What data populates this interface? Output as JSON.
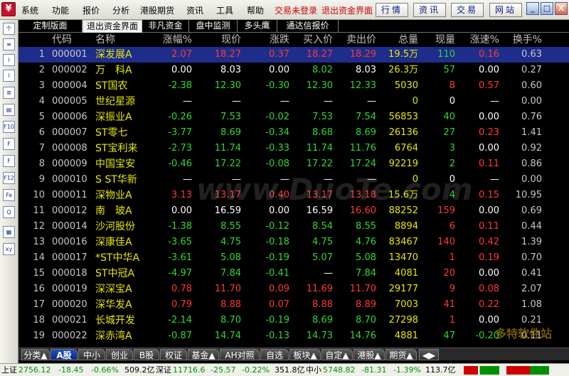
{
  "menubar": {
    "items": [
      "系统",
      "功能",
      "报价",
      "分析",
      "港股期货",
      "资讯",
      "工具",
      "帮助"
    ],
    "status_texts": [
      "交易未登录",
      "退出资金界面"
    ],
    "toolbar_buttons": [
      "行情",
      "资讯",
      "交易",
      "网站"
    ],
    "window_buttons": [
      "_",
      "□",
      "X"
    ]
  },
  "left_toolbar": [
    "个",
    "≡",
    "⌇",
    "⌇",
    "≣",
    "▤",
    "F10",
    "F",
    "F",
    "F12",
    "Fa",
    "Q",
    "▦",
    "xy"
  ],
  "tabs": [
    "定制版面",
    "退出资金界面",
    "非凡资金",
    "盘中监测",
    "多头鹰",
    "通达信报价"
  ],
  "active_tab_index": 1,
  "columns": [
    "代码",
    "名称",
    "涨幅%",
    "现价",
    "涨跌",
    "买入价",
    "卖出价",
    "总量",
    "现量",
    "涨速%",
    "换手%"
  ],
  "rows": [
    {
      "idx": "1",
      "code": "000001",
      "name": "深发展A",
      "chg": "2.07",
      "price": "18.27",
      "diff": "0.37",
      "buy": "18.27",
      "sell": "18.29",
      "vol": "19.5万",
      "cur": "110",
      "spd": "0.16",
      "turn": "0.63",
      "dir": "up",
      "cur_dir": "dn",
      "spd_dir": "up"
    },
    {
      "idx": "2",
      "code": "000002",
      "name": "万　科A",
      "chg": "0.00",
      "price": "8.03",
      "diff": "0.00",
      "buy": "8.02",
      "sell": "8.03",
      "vol": "26.3万",
      "cur": "57",
      "spd": "0.00",
      "turn": "0.27",
      "dir": "flat",
      "cur_dir": "dn",
      "spd_dir": "flat",
      "buy_dir": "dn"
    },
    {
      "idx": "3",
      "code": "000004",
      "name": "ST国农",
      "chg": "-2.38",
      "price": "12.30",
      "diff": "-0.30",
      "buy": "12.30",
      "sell": "12.33",
      "vol": "5030",
      "cur": "8",
      "spd": "0.57",
      "turn": "0.60",
      "dir": "dn",
      "cur_dir": "up",
      "spd_dir": "up"
    },
    {
      "idx": "4",
      "code": "000005",
      "name": "世纪星源",
      "chg": "—",
      "price": "—",
      "diff": "—",
      "buy": "—",
      "sell": "—",
      "vol": "0",
      "cur": "0",
      "spd": "—",
      "turn": "0.00",
      "dir": "flat",
      "cur_dir": "flat",
      "spd_dir": "flat"
    },
    {
      "idx": "5",
      "code": "000006",
      "name": "深振业A",
      "chg": "-0.26",
      "price": "7.53",
      "diff": "-0.02",
      "buy": "7.53",
      "sell": "7.54",
      "vol": "56853",
      "cur": "40",
      "spd": "0.00",
      "turn": "0.76",
      "dir": "dn",
      "cur_dir": "dn",
      "spd_dir": "flat"
    },
    {
      "idx": "6",
      "code": "000007",
      "name": "ST零七",
      "chg": "-3.77",
      "price": "8.69",
      "diff": "-0.34",
      "buy": "8.68",
      "sell": "8.69",
      "vol": "26136",
      "cur": "27",
      "spd": "0.23",
      "turn": "1.41",
      "dir": "dn",
      "cur_dir": "dn",
      "spd_dir": "up"
    },
    {
      "idx": "7",
      "code": "000008",
      "name": "ST宝利来",
      "chg": "-2.73",
      "price": "11.74",
      "diff": "-0.33",
      "buy": "11.74",
      "sell": "11.76",
      "vol": "6764",
      "cur": "3",
      "spd": "0.00",
      "turn": "0.92",
      "dir": "dn",
      "cur_dir": "dn",
      "spd_dir": "flat"
    },
    {
      "idx": "8",
      "code": "000009",
      "name": "中国宝安",
      "chg": "-0.46",
      "price": "17.22",
      "diff": "-0.08",
      "buy": "17.22",
      "sell": "17.24",
      "vol": "92219",
      "cur": "2",
      "spd": "0.11",
      "turn": "0.86",
      "dir": "dn",
      "cur_dir": "dn",
      "spd_dir": "up"
    },
    {
      "idx": "9",
      "code": "000010",
      "name": "S ST华新",
      "chg": "—",
      "price": "—",
      "diff": "—",
      "buy": "—",
      "sell": "—",
      "vol": "0",
      "cur": "0",
      "spd": "—",
      "turn": "0.00",
      "dir": "flat",
      "cur_dir": "flat",
      "spd_dir": "flat"
    },
    {
      "idx": "10",
      "code": "000011",
      "name": "深物业A",
      "chg": "3.13",
      "price": "13.17",
      "diff": "0.40",
      "buy": "13.17",
      "sell": "13.18",
      "vol": "15.6万",
      "cur": "4",
      "spd": "0.15",
      "turn": "10.95",
      "dir": "up",
      "cur_dir": "dn",
      "spd_dir": "up"
    },
    {
      "idx": "11",
      "code": "000012",
      "name": "南　玻A",
      "chg": "0.00",
      "price": "16.59",
      "diff": "0.00",
      "buy": "16.59",
      "sell": "16.60",
      "vol": "88252",
      "cur": "159",
      "spd": "0.00",
      "turn": "0.69",
      "dir": "flat",
      "cur_dir": "up",
      "spd_dir": "flat",
      "sell_dir": "up"
    },
    {
      "idx": "12",
      "code": "000014",
      "name": "沙河股份",
      "chg": "-1.38",
      "price": "8.55",
      "diff": "-0.12",
      "buy": "8.54",
      "sell": "8.55",
      "vol": "8894",
      "cur": "6",
      "spd": "0.11",
      "turn": "0.44",
      "dir": "dn",
      "cur_dir": "up",
      "spd_dir": "up"
    },
    {
      "idx": "13",
      "code": "000016",
      "name": "深康佳A",
      "chg": "-3.65",
      "price": "4.75",
      "diff": "-0.18",
      "buy": "4.75",
      "sell": "4.76",
      "vol": "83467",
      "cur": "140",
      "spd": "0.42",
      "turn": "1.39",
      "dir": "dn",
      "cur_dir": "up",
      "spd_dir": "up"
    },
    {
      "idx": "14",
      "code": "000017",
      "name": "*ST中华A",
      "chg": "-3.61",
      "price": "5.08",
      "diff": "-0.19",
      "buy": "5.07",
      "sell": "5.08",
      "vol": "13470",
      "cur": "1",
      "spd": "0.19",
      "turn": "0.70",
      "dir": "dn",
      "cur_dir": "up",
      "spd_dir": "up"
    },
    {
      "idx": "15",
      "code": "000018",
      "name": "ST中冠A",
      "chg": "-4.97",
      "price": "7.84",
      "diff": "-0.41",
      "buy": "—",
      "sell": "7.84",
      "vol": "4081",
      "cur": "20",
      "spd": "0.00",
      "turn": "0.41",
      "dir": "dn",
      "cur_dir": "up",
      "spd_dir": "flat",
      "buy_dir": "flat"
    },
    {
      "idx": "16",
      "code": "000019",
      "name": "深深宝A",
      "chg": "0.78",
      "price": "11.70",
      "diff": "0.09",
      "buy": "11.69",
      "sell": "11.70",
      "vol": "29177",
      "cur": "9",
      "spd": "0.08",
      "turn": "2.07",
      "dir": "up",
      "cur_dir": "up",
      "spd_dir": "up"
    },
    {
      "idx": "17",
      "code": "000020",
      "name": "深华发A",
      "chg": "0.79",
      "price": "8.88",
      "diff": "0.07",
      "buy": "8.88",
      "sell": "8.89",
      "vol": "7003",
      "cur": "41",
      "spd": "0.22",
      "turn": "1.08",
      "dir": "up",
      "cur_dir": "up",
      "spd_dir": "up"
    },
    {
      "idx": "18",
      "code": "000021",
      "name": "长城开发",
      "chg": "-2.14",
      "price": "8.70",
      "diff": "-0.19",
      "buy": "8.69",
      "sell": "8.70",
      "vol": "27298",
      "cur": "1",
      "spd": "0.00",
      "turn": "0.21",
      "dir": "dn",
      "cur_dir": "up",
      "spd_dir": "flat"
    },
    {
      "idx": "19",
      "code": "000022",
      "name": "深赤湾A",
      "chg": "-0.87",
      "price": "14.74",
      "diff": "-0.13",
      "buy": "14.73",
      "sell": "14.76",
      "vol": "4881",
      "cur": "47",
      "spd": "-0.20",
      "turn": "0.11",
      "dir": "dn",
      "cur_dir": "dn",
      "spd_dir": "dn"
    }
  ],
  "market_tabs": [
    "分类▲",
    "A股",
    "中小",
    "创业",
    "B股",
    "权证",
    "基金▲",
    "AH对照",
    "自选",
    "板块▲",
    "自定▲",
    "港股▲",
    "期货▲"
  ],
  "active_market_index": 1,
  "index_bar": {
    "sh_label": "上证",
    "sh_value": "2756.12",
    "sh_chg": "-18.45",
    "sh_pct": "-0.66%",
    "sh_amt": "509.2亿",
    "sz_label": "深证",
    "sz_value": "11716.6",
    "sz_chg": "-25.57",
    "sz_pct": "-0.22%",
    "sz_amt": "351.8亿",
    "zx_label": "中小",
    "zx_value": "5748.82",
    "zx_chg": "-81.31",
    "zx_pct": "-1.39%",
    "zx_amt": "113.7亿"
  },
  "watermarks": [
    "www.DuoTe.com",
    "多特软件站"
  ],
  "colors": {
    "up": "#ff3838",
    "down": "#33d633",
    "name": "#e8e800",
    "selected": "#1e2d8c"
  }
}
